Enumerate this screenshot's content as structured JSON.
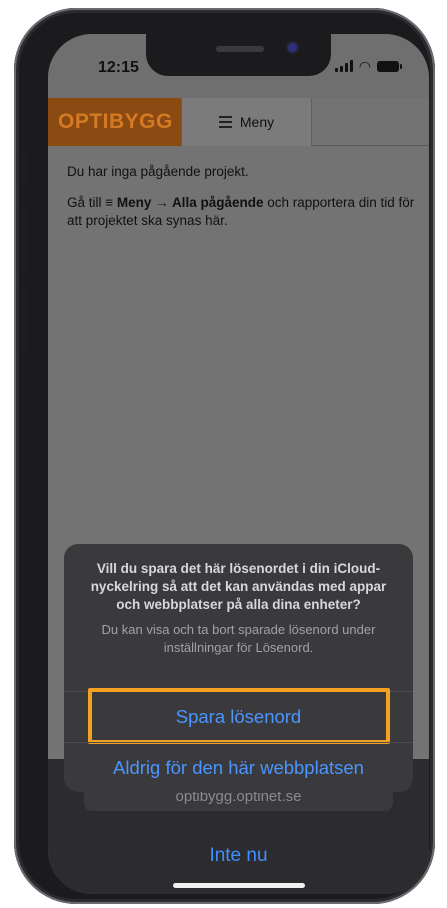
{
  "status_bar": {
    "time": "12:15"
  },
  "site": {
    "logo": "OPTIBYGG",
    "menu_label": "Meny"
  },
  "content": {
    "no_projects": "Du har inga pågående projekt.",
    "instr_prefix": "Gå till ",
    "instr_menu_icon": "≡",
    "instr_menu": " Meny",
    "instr_arrow": " → ",
    "instr_all": "Alla pågående",
    "instr_suffix": " och rapportera din tid för att projektet ska synas här."
  },
  "password_sheet": {
    "title": "Vill du spara det här lösenordet i din iCloud-nyckelring så att det kan användas med appar och webbplatser på alla dina enheter?",
    "subtitle": "Du kan visa och ta bort sparade lösenord under inställningar för Lösenord.",
    "save_label": "Spara lösenord",
    "never_label": "Aldrig för den här webbplatsen",
    "highlight_color": "#f4a020"
  },
  "bottom": {
    "url": "optibygg.optinet.se",
    "not_now_label": "Inte nu"
  },
  "colors": {
    "link_blue": "#4a95ff",
    "logo_orange": "#d47a22"
  }
}
